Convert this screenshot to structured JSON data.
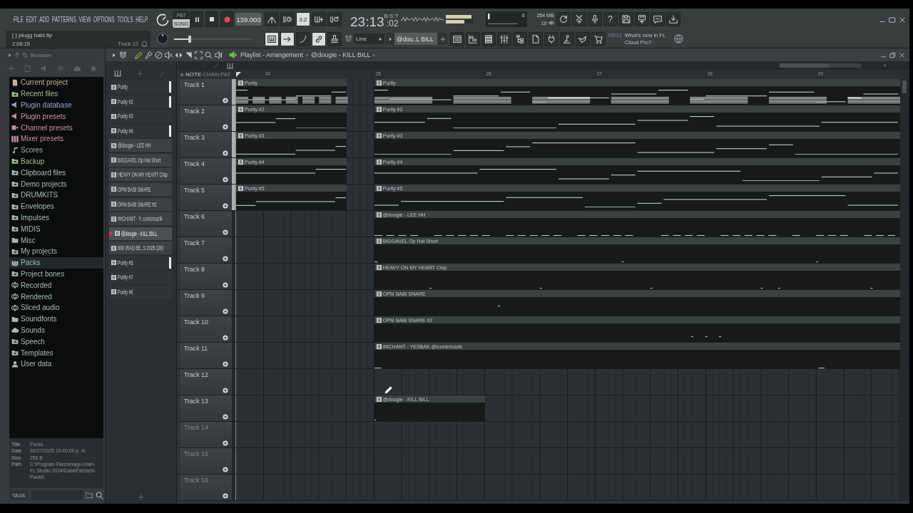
{
  "menu": [
    "FILE",
    "EDIT",
    "ADD",
    "PATTERNS",
    "VIEW",
    "OPTIONS",
    "TOOLS",
    "HELP"
  ],
  "hint": {
    "file": "[ ] plugg babi.flp",
    "time": "2:06:15",
    "target": "Track 12"
  },
  "mode_switch": [
    {
      "label": "PAT",
      "selected": false
    },
    {
      "label": "SONG",
      "selected": true
    }
  ],
  "transport": {
    "playing": true,
    "tempo": "139.000"
  },
  "toggles": [
    {
      "on": false
    },
    {
      "on": false
    },
    {
      "on": true,
      "label": "3.2"
    },
    {
      "on": false
    },
    {
      "on": false
    }
  ],
  "clock": {
    "time": "23:13",
    "ticks": ":02",
    "format": "B:S:T"
  },
  "output_meter": [
    {
      "level": 0.95
    },
    {
      "level": 0.7
    }
  ],
  "monitor": {
    "cpu": "6",
    "memory": "254 MB",
    "voices": "10"
  },
  "help_label": "?",
  "pitch_slider": {
    "level": 0.2
  },
  "tool_modes": [
    {
      "on": true
    },
    {
      "on": true
    },
    {
      "on": false
    },
    {
      "on": true
    },
    {
      "on": false
    }
  ],
  "snap": "Line",
  "pattern_selector": "@dou..L BILL",
  "news": {
    "count": "09/12",
    "headline": "What's new in FL Cloud Pro?"
  },
  "browser": {
    "title": "Browser",
    "items": [
      {
        "label": "Current project",
        "kind": "file",
        "color": "#c6b394",
        "selected": false
      },
      {
        "label": "Recent files",
        "kind": "linked",
        "color": "#9fbf8b",
        "selected": false
      },
      {
        "label": "Plugin database",
        "kind": "plugin",
        "color": "#8ea8cc",
        "selected": false
      },
      {
        "label": "Plugin presets",
        "kind": "plugin",
        "color": "#c890a8",
        "selected": false
      },
      {
        "label": "Channel presets",
        "kind": "channel",
        "color": "#c890a8",
        "selected": false
      },
      {
        "label": "Mixer presets",
        "kind": "mixer",
        "color": "#c890a8",
        "selected": false
      },
      {
        "label": "Scores",
        "kind": "note",
        "color": "#a3aaa9",
        "selected": false
      },
      {
        "label": "Backup",
        "kind": "linked",
        "color": "#9fbf8b",
        "selected": false
      },
      {
        "label": "Clipboard files",
        "kind": "linked",
        "color": "#a8bab8",
        "selected": false
      },
      {
        "label": "Demo projects",
        "kind": "linked",
        "color": "#a8bab8",
        "selected": false
      },
      {
        "label": "DRUMKITS",
        "kind": "linked",
        "color": "#a8bab8",
        "selected": false
      },
      {
        "label": "Envelopes",
        "kind": "linked",
        "color": "#a8bab8",
        "selected": false
      },
      {
        "label": "Impulses",
        "kind": "linked",
        "color": "#a8bab8",
        "selected": false
      },
      {
        "label": "MIDIS",
        "kind": "linked",
        "color": "#a8bab8",
        "selected": false
      },
      {
        "label": "Misc",
        "kind": "folder",
        "color": "#a8bab8",
        "selected": false
      },
      {
        "label": "My projects",
        "kind": "linked",
        "color": "#a8bab8",
        "selected": false
      },
      {
        "label": "Packs",
        "kind": "packs",
        "color": "#a8bab8",
        "selected": true
      },
      {
        "label": "Project bones",
        "kind": "linked",
        "color": "#a8bab8",
        "selected": false
      },
      {
        "label": "Recorded",
        "kind": "audio",
        "color": "#a8bab8",
        "selected": false
      },
      {
        "label": "Rendered",
        "kind": "audio",
        "color": "#a8bab8",
        "selected": false
      },
      {
        "label": "Sliced audio",
        "kind": "audio",
        "color": "#a8bab8",
        "selected": false
      },
      {
        "label": "Soundfonts",
        "kind": "folder",
        "color": "#a8bab8",
        "selected": false
      },
      {
        "label": "Sounds",
        "kind": "cloud",
        "color": "#a8bab8",
        "selected": false
      },
      {
        "label": "Speech",
        "kind": "linked",
        "color": "#a8bab8",
        "selected": false
      },
      {
        "label": "Templates",
        "kind": "linked",
        "color": "#a8bab8",
        "selected": false
      },
      {
        "label": "User data",
        "kind": "user",
        "color": "#a8bab8",
        "selected": false
      }
    ],
    "info": [
      {
        "label": "Title",
        "value": "Packs"
      },
      {
        "label": "Date",
        "value": "30/07/2025 10:40:00 p. m."
      },
      {
        "label": "Size",
        "value": "259 B"
      },
      {
        "label": "Path",
        "value": "C:\\Program Files\\Image-Line\\-\nFL Studio 2024\\Data\\Patches\\-\nPacks\\"
      }
    ],
    "tags_label": "TAGS"
  },
  "playlist": {
    "tools": [
      {
        "selected": true
      },
      {
        "selected": false
      },
      {
        "selected": false
      },
      {
        "selected": false
      },
      {
        "selected": false
      },
      {
        "selected": false
      },
      {
        "selected": false
      },
      {
        "selected": false
      },
      {
        "selected": false
      }
    ],
    "title": "Playlist - Arrangement",
    "pattern": "@dougie - KILL BILL",
    "patterns": [
      {
        "label": "Purity",
        "kind": "melodic",
        "marked": true,
        "selected": false
      },
      {
        "label": "Purity #2",
        "kind": "melodic",
        "marked": true,
        "selected": false
      },
      {
        "label": "Purity #3",
        "kind": "melodic",
        "marked": false,
        "selected": false
      },
      {
        "label": "Purity #4",
        "kind": "melodic",
        "marked": true,
        "selected": false
      },
      {
        "label": "@dougie - LEE HH",
        "kind": "plain",
        "marked": false,
        "selected": false
      },
      {
        "label": "BIGGAVEL Op Hat Short",
        "kind": "plain",
        "marked": false,
        "selected": false
      },
      {
        "label": "HEAVY ON MY HEART Clap",
        "kind": "plain",
        "marked": false,
        "selected": false
      },
      {
        "label": "OPM BABI SNARE",
        "kind": "plain",
        "marked": false,
        "selected": false
      },
      {
        "label": "OPM BABI SNARE #2",
        "kind": "plain",
        "marked": false,
        "selected": false
      },
      {
        "label": "##CHANT - Y..conicmuzik",
        "kind": "plain",
        "marked": false,
        "selected": false
      },
      {
        "label": "@dougie - KILL BILL",
        "kind": "plain",
        "marked": false,
        "selected": true
      },
      {
        "label": "808 IRAD BE..S 2025 (28)",
        "kind": "plain",
        "marked": false,
        "selected": false
      },
      {
        "label": "Purity #5",
        "kind": "melodic",
        "marked": true,
        "selected": false
      },
      {
        "label": "Purity #7",
        "kind": "melodic",
        "marked": false,
        "selected": false
      },
      {
        "label": "Purity #6",
        "kind": "melodic",
        "marked": false,
        "selected": false
      }
    ],
    "filters": [
      {
        "label": "NOTE",
        "selected": true
      },
      {
        "label": "CHAN",
        "selected": false
      },
      {
        "label": "PAT",
        "selected": false
      }
    ],
    "bars": [
      "24",
      "25",
      "26",
      "27",
      "28",
      "29"
    ],
    "tracks": [
      {
        "name": "Track 1",
        "dimmed": false,
        "kind": "melodic",
        "clips": [
          {
            "label": "Purity",
            "kind": "pickup"
          },
          {
            "label": "Purity",
            "kind": "long"
          }
        ]
      },
      {
        "name": "Track 2",
        "dimmed": false,
        "kind": "melodic",
        "clips": [
          {
            "label": "Purity #2",
            "kind": "pickup"
          },
          {
            "label": "Purity #2",
            "kind": "long"
          }
        ]
      },
      {
        "name": "Track 3",
        "dimmed": false,
        "kind": "melodic",
        "clips": [
          {
            "label": "Purity #3",
            "kind": "pickup"
          },
          {
            "label": "Purity #3",
            "kind": "long"
          }
        ]
      },
      {
        "name": "Track 4",
        "dimmed": false,
        "kind": "melodic",
        "clips": [
          {
            "label": "Purity #4",
            "kind": "pickup"
          },
          {
            "label": "Purity #4",
            "kind": "long"
          }
        ]
      },
      {
        "name": "Track 5",
        "dimmed": false,
        "kind": "melodic",
        "clips": [
          {
            "label": "Purity #5",
            "kind": "pickup"
          },
          {
            "label": "Purity #5",
            "kind": "long"
          }
        ]
      },
      {
        "name": "Track 6",
        "dimmed": false,
        "kind": "plain",
        "clips": [
          {
            "label": "@dougie - LEE HH",
            "kind": "long"
          }
        ]
      },
      {
        "name": "Track 7",
        "dimmed": false,
        "kind": "plain",
        "clips": [
          {
            "label": "BIGGAVEL Op Hat Short",
            "kind": "long"
          }
        ]
      },
      {
        "name": "Track 8",
        "dimmed": false,
        "kind": "plain",
        "clips": [
          {
            "label": "HEAVY ON MY HEART Clap",
            "kind": "long"
          }
        ]
      },
      {
        "name": "Track 9",
        "dimmed": false,
        "kind": "plain",
        "clips": [
          {
            "label": "OPM BABI SNARE",
            "kind": "long"
          }
        ]
      },
      {
        "name": "Track 10",
        "dimmed": false,
        "kind": "plain",
        "clips": [
          {
            "label": "OPM BABI SNARE #2",
            "kind": "long"
          }
        ]
      },
      {
        "name": "Track 11",
        "dimmed": false,
        "kind": "plain",
        "clips": [
          {
            "label": "##CHANT - YESBAK @iconicmuzik",
            "kind": "long"
          }
        ]
      },
      {
        "name": "Track 12",
        "dimmed": false,
        "kind": "plain"
      },
      {
        "name": "Track 13",
        "dimmed": false,
        "kind": "plain",
        "clips": [
          {
            "label": "@dougie - KILL BILL",
            "kind": "bar"
          }
        ]
      },
      {
        "name": "Track 14",
        "dimmed": true,
        "kind": "plain"
      },
      {
        "name": "Track 15",
        "dimmed": true,
        "kind": "plain"
      },
      {
        "name": "Track 16",
        "dimmed": true,
        "kind": "plain"
      }
    ]
  }
}
